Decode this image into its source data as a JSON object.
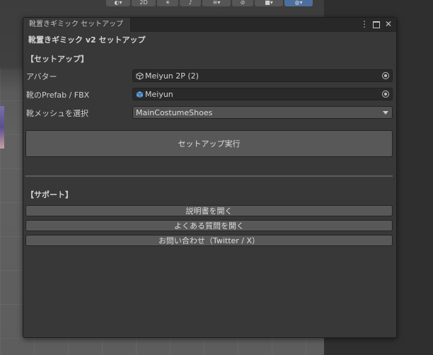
{
  "toolbar": {
    "btn_2d": "2D"
  },
  "window": {
    "tab_title": "靴置きギミック セットアップ",
    "panel_title": "靴置きギミック v2 セットアップ"
  },
  "setup": {
    "header": "【セットアップ】",
    "avatar_label": "アバター",
    "avatar_value": "Meiyun 2P (2)",
    "prefab_label": "靴のPrefab / FBX",
    "prefab_value": "Meiyun",
    "mesh_label": "靴メッシュを選択",
    "mesh_value": "MainCostumeShoes",
    "run_button": "セットアップ実行"
  },
  "support": {
    "header": "【サポート】",
    "manual_button": "説明書を開く",
    "faq_button": "よくある質問を開く",
    "contact_button": "お問い合わせ（Twitter / X）"
  }
}
